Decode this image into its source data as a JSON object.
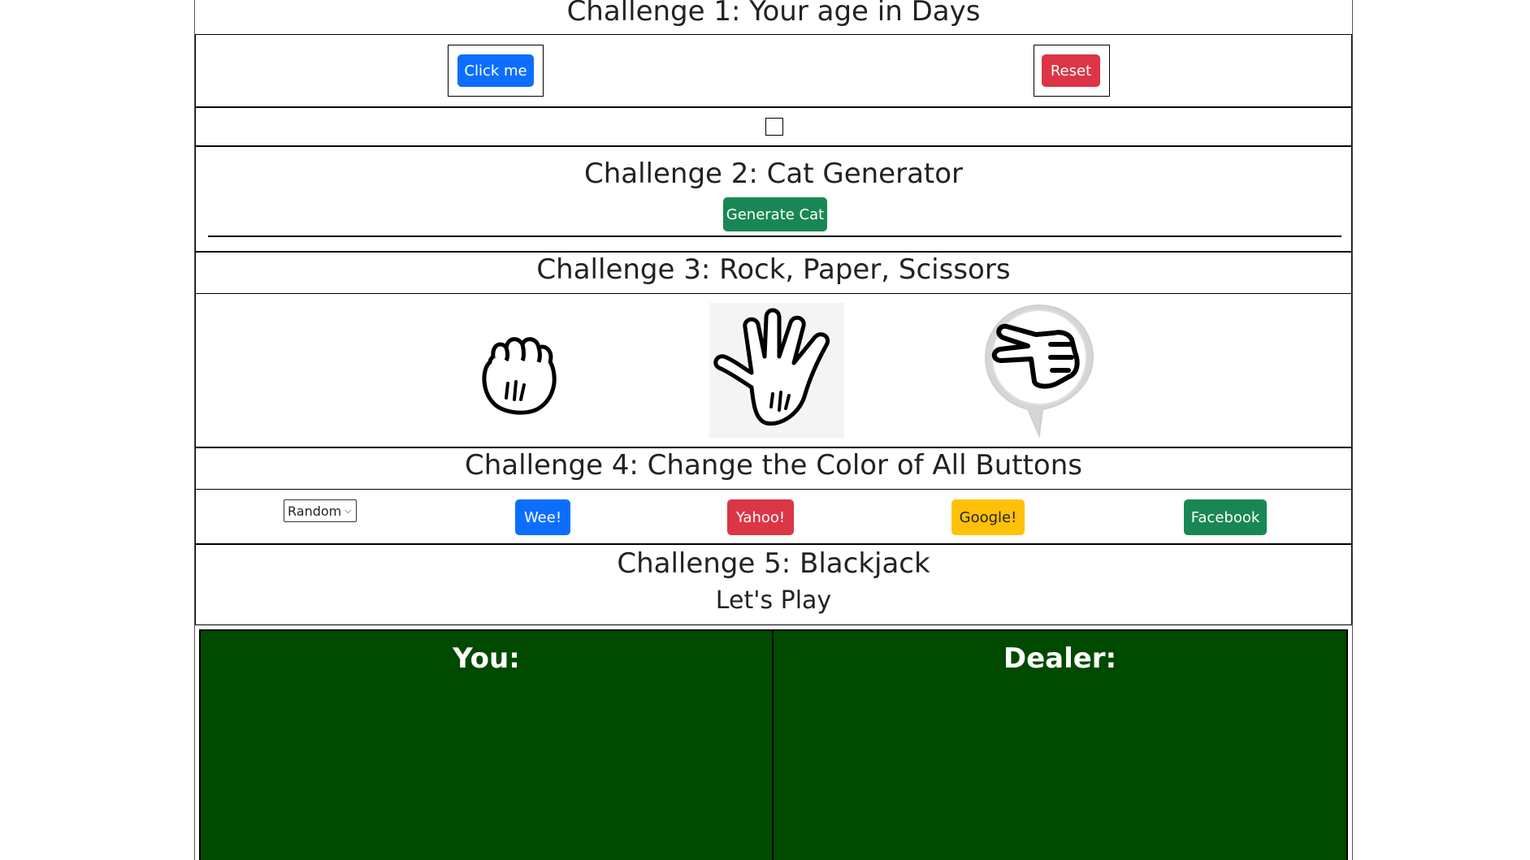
{
  "challenge1": {
    "title": "Challenge 1: Your age in Days",
    "click_label": "Click me",
    "reset_label": "Reset"
  },
  "challenge2": {
    "title": "Challenge 2: Cat Generator",
    "generate_label": "Generate Cat"
  },
  "challenge3": {
    "title": "Challenge 3: Rock, Paper, Scissors",
    "choices": [
      "rock",
      "paper",
      "scissors"
    ]
  },
  "challenge4": {
    "title": "Challenge 4: Change the Color of All Buttons",
    "select_value": "Random",
    "buttons": [
      "Wee!",
      "Yahoo!",
      "Google!",
      "Facebook"
    ]
  },
  "challenge5": {
    "title": "Challenge 5: Blackjack",
    "subtitle": "Let's Play",
    "you_label": "You:",
    "dealer_label": "Dealer:"
  },
  "colors": {
    "blue": "#0d6efd",
    "red": "#dc3545",
    "green": "#198754",
    "yellow": "#ffc107",
    "table_green": "#004a00"
  }
}
